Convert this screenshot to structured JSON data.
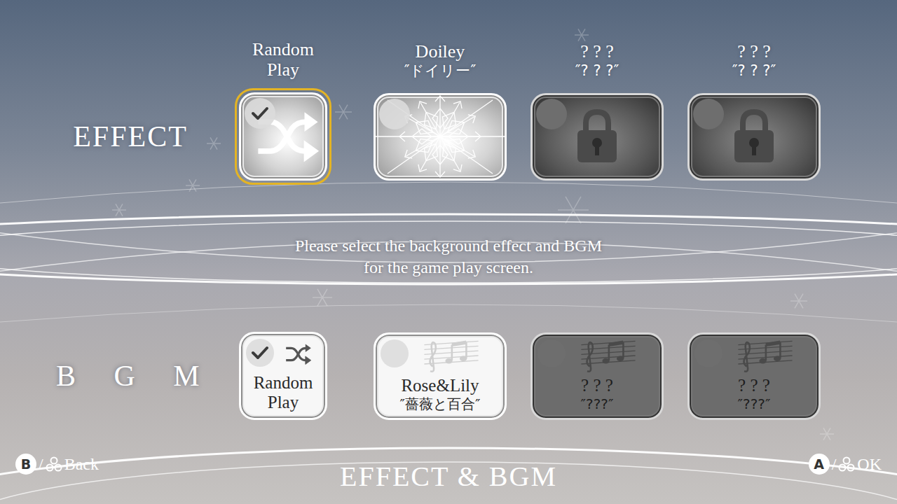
{
  "effect": {
    "label": "EFFECT",
    "items": [
      {
        "kind": "random",
        "title_lines": [
          "Random",
          "Play"
        ],
        "selected": true,
        "checked": true,
        "locked": false
      },
      {
        "kind": "doiley",
        "title_lines": [
          "Doiley"
        ],
        "subtitle": "″ドイリー″",
        "selected": false,
        "checked": false,
        "locked": false
      },
      {
        "kind": "locked",
        "title_lines": [
          "? ? ?"
        ],
        "subtitle": "″? ? ?″",
        "selected": false,
        "checked": false,
        "locked": true
      },
      {
        "kind": "locked",
        "title_lines": [
          "? ? ?"
        ],
        "subtitle": "″? ? ?″",
        "selected": false,
        "checked": false,
        "locked": true
      }
    ]
  },
  "message": {
    "lines": [
      "Please select the background effect and BGM",
      "for the game play screen."
    ]
  },
  "bgm": {
    "label": "B G M",
    "items": [
      {
        "kind": "random",
        "title_lines": [
          "Random",
          "Play"
        ],
        "selected": false,
        "checked": true,
        "locked": false
      },
      {
        "kind": "track",
        "title_lines": [
          "Rose&Lily"
        ],
        "subtitle": "″薔薇と百合″",
        "selected": false,
        "checked": false,
        "locked": false
      },
      {
        "kind": "track",
        "title_lines": [
          "? ? ?"
        ],
        "subtitle": "″???″",
        "selected": false,
        "checked": false,
        "locked": true
      },
      {
        "kind": "track",
        "title_lines": [
          "? ? ?"
        ],
        "subtitle": "″???″",
        "selected": false,
        "checked": false,
        "locked": true
      }
    ]
  },
  "footer": {
    "back": {
      "key": "B",
      "separator": "/",
      "label": "Back"
    },
    "title": "EFFECT & BGM",
    "ok": {
      "key": "A",
      "separator": "/",
      "label": "OK"
    }
  }
}
